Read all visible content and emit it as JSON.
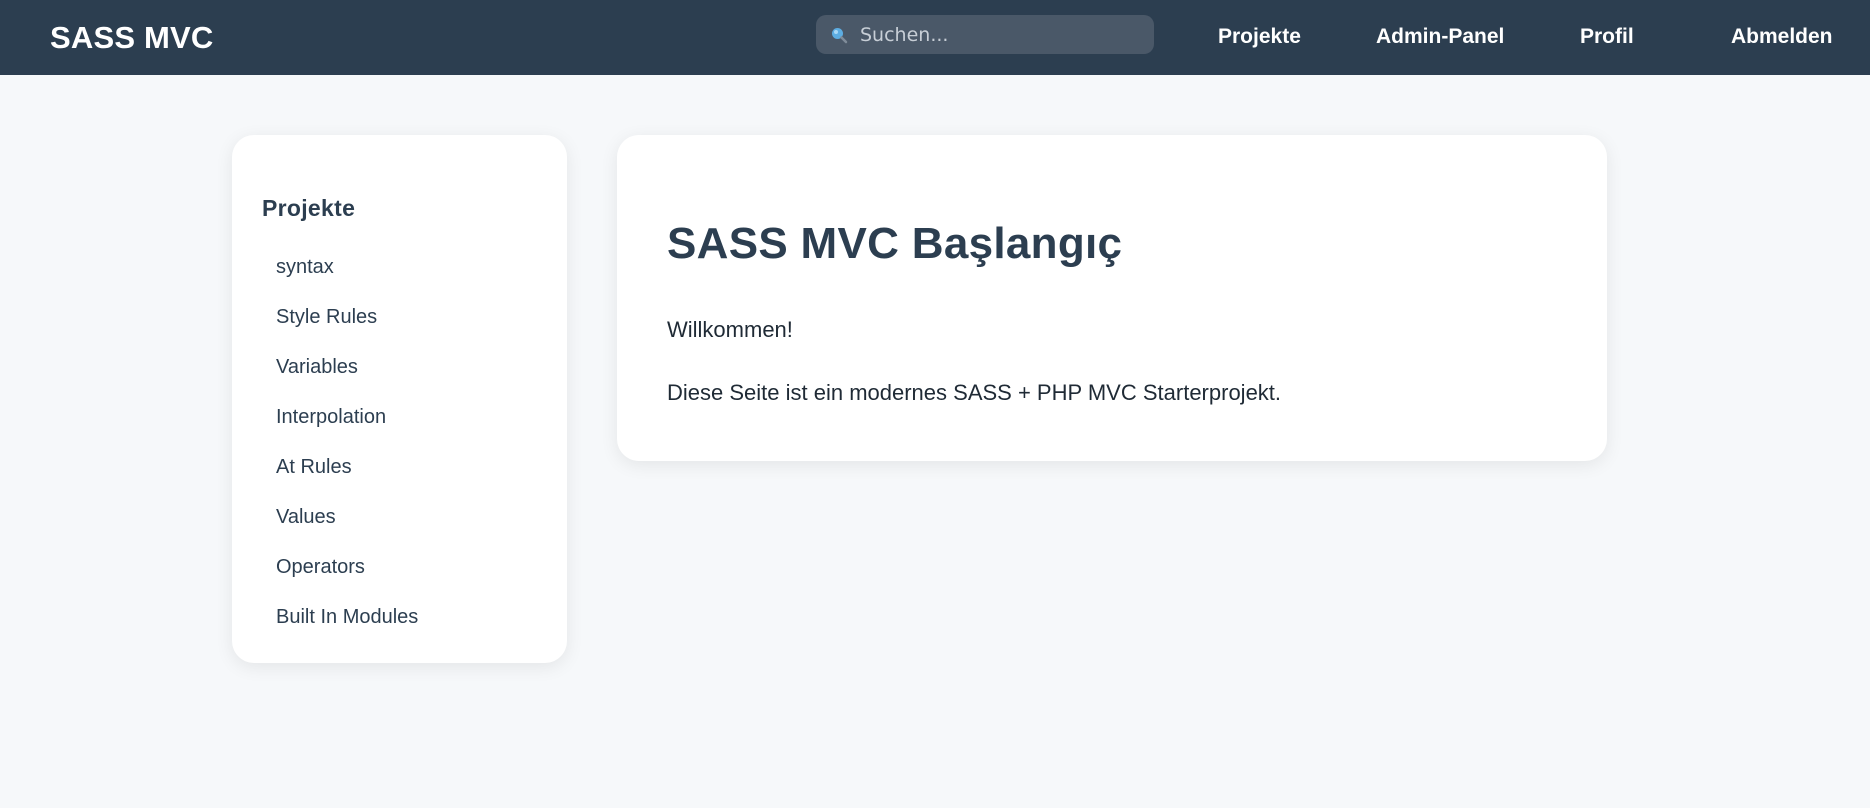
{
  "header": {
    "brand": "SASS MVC",
    "search": {
      "placeholder": "Suchen...",
      "value": ""
    },
    "nav": {
      "projects": "Projekte",
      "admin": "Admin-Panel",
      "profile": "Profil",
      "logout": "Abmelden"
    }
  },
  "sidebar": {
    "title": "Projekte",
    "items": [
      {
        "label": "syntax"
      },
      {
        "label": "Style Rules"
      },
      {
        "label": "Variables"
      },
      {
        "label": "Interpolation"
      },
      {
        "label": "At Rules"
      },
      {
        "label": "Values"
      },
      {
        "label": "Operators"
      },
      {
        "label": "Built In Modules"
      }
    ]
  },
  "main": {
    "title": "SASS MVC Başlangıç",
    "welcome": "Willkommen!",
    "description": "Diese Seite ist ein modernes SASS + PHP MVC Starterprojekt."
  },
  "icons": {
    "search": "search-icon"
  },
  "colors": {
    "header_bg": "#2c3e50",
    "page_bg": "#f6f8fa",
    "accent_text": "#2c3e50",
    "search_bg": "#4a5868",
    "search_icon": "#5dade2"
  }
}
